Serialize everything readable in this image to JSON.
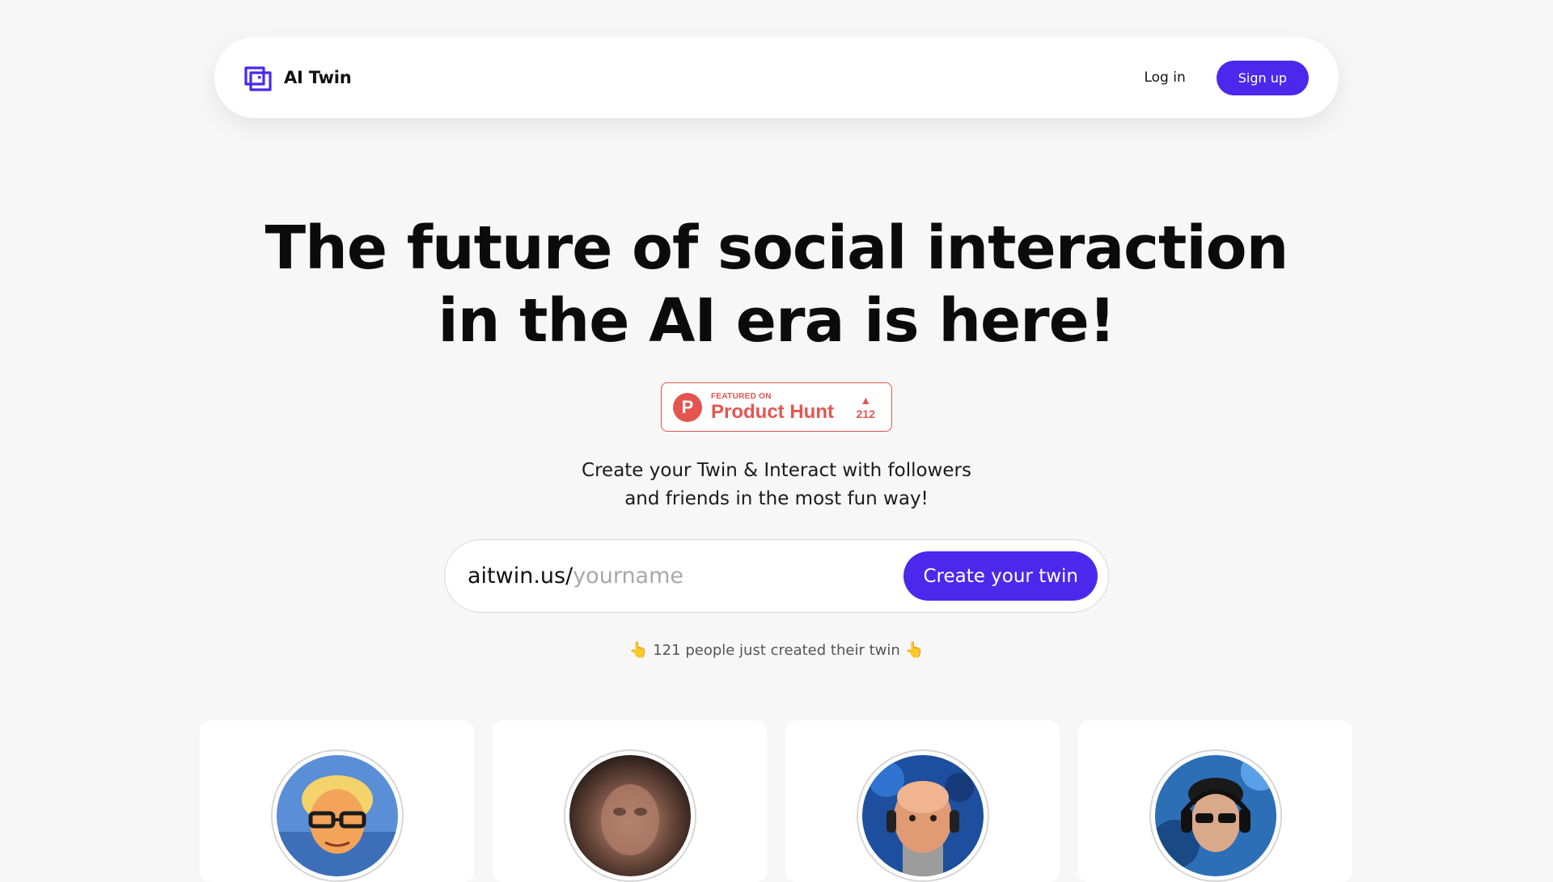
{
  "navbar": {
    "brand_name": "AI Twin",
    "login_label": "Log in",
    "signup_label": "Sign up",
    "logo_icon": "ai-twin-logo-icon"
  },
  "hero": {
    "title_line_1": "The future of social interaction",
    "title_line_2": "in the AI era is here!",
    "subtitle_line_1": "Create your Twin & Interact with followers",
    "subtitle_line_2": "and friends in the most fun way!"
  },
  "product_hunt": {
    "featured_label": "FEATURED ON",
    "name": "Product Hunt",
    "logo_letter": "P",
    "votes": "212",
    "vote_icon": "upvote-triangle-icon"
  },
  "create_form": {
    "url_prefix": "aitwin.us/",
    "input_value": "",
    "input_placeholder": "yourname",
    "button_label": "Create your twin"
  },
  "social_proof": {
    "left_icon": "👆",
    "text": "121 people just created their twin",
    "right_icon": "👆"
  },
  "twin_cards": [
    {
      "avatar": "cartoon-older-man-glasses-avatar"
    },
    {
      "avatar": "blurred-man-portrait-avatar"
    },
    {
      "avatar": "bald-man-headphones-painting-avatar"
    },
    {
      "avatar": "man-sunglasses-headphones-avatar"
    }
  ],
  "colors": {
    "accent": "#4b29ec",
    "product_hunt": "#e4554f",
    "background": "#f7f7f7"
  }
}
